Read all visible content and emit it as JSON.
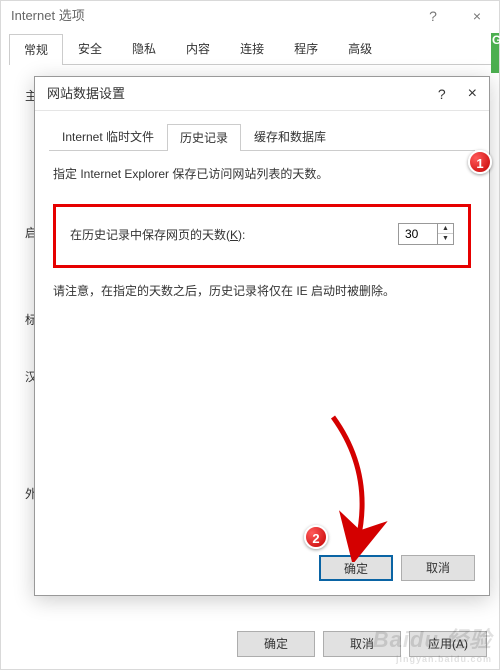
{
  "parent": {
    "title": "Internet 选项",
    "help_icon": "?",
    "close_icon": "×",
    "tabs": [
      "常规",
      "安全",
      "隐私",
      "内容",
      "连接",
      "程序",
      "高级"
    ],
    "active_tab": 0,
    "body_lines": [
      "主",
      "启",
      "标",
      "汉",
      "外"
    ],
    "footer": {
      "ok": "确定",
      "cancel": "取消",
      "apply": "应用(A)"
    },
    "green_badge": "G"
  },
  "child": {
    "title": "网站数据设置",
    "help_icon": "?",
    "close_icon": "×",
    "tabs": [
      "Internet 临时文件",
      "历史记录",
      "缓存和数据库"
    ],
    "active_tab": 1,
    "description": "指定 Internet Explorer 保存已访问网站列表的天数。",
    "days_label_pre": "在历史记录中保存网页的天数(",
    "days_label_key": "K",
    "days_label_post": "):",
    "days_value": "30",
    "note": "请注意，在指定的天数之后，历史记录将仅在 IE 启动时被删除。",
    "footer": {
      "ok": "确定",
      "cancel": "取消"
    }
  },
  "markers": {
    "m1": "1",
    "m2": "2"
  },
  "watermark": {
    "brand": "Baidu 经验",
    "url": "jingyan.baidu.com"
  }
}
